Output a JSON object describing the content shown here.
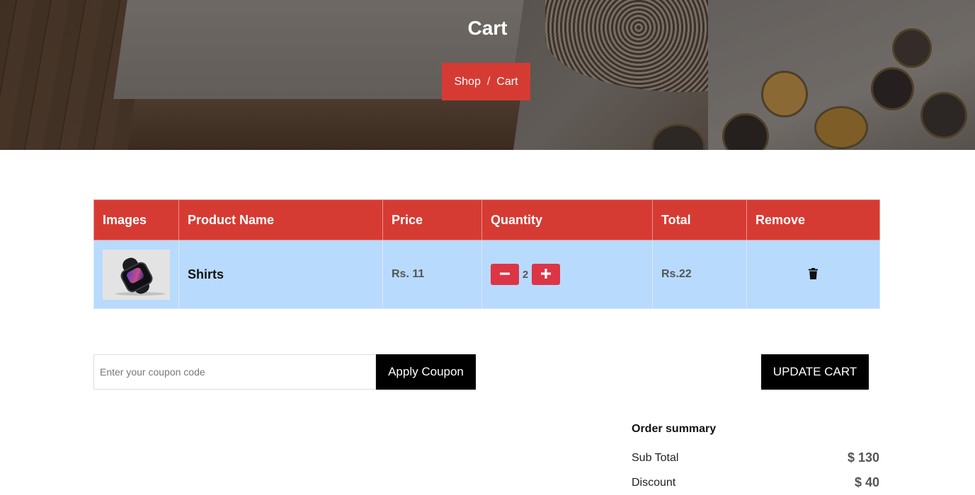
{
  "hero": {
    "title": "Cart",
    "breadcrumb": {
      "shop": "Shop",
      "separator": "/",
      "current": "Cart"
    },
    "breadcrumb_bg": "#d63b33"
  },
  "table": {
    "headers": [
      "Images",
      "Product Name",
      "Price",
      "Quantity",
      "Total",
      "Remove"
    ],
    "rows": [
      {
        "product": "Shirts",
        "price": "Rs. 11",
        "quantity": "2",
        "total": "Rs.22"
      }
    ],
    "header_bg": "#d63b33",
    "row_bg": "#b8dafc"
  },
  "icons": {
    "minus": "minus-icon",
    "plus": "plus-icon",
    "remove": "trash-icon"
  },
  "coupon": {
    "placeholder": "Enter your coupon code",
    "apply_label": "Apply Coupon"
  },
  "update_label": "UPDATE CART",
  "summary": {
    "title": "Order summary",
    "rows": [
      {
        "label": "Sub Total",
        "value": "$ 130"
      },
      {
        "label": "Discount",
        "value": "$ 40"
      }
    ]
  }
}
